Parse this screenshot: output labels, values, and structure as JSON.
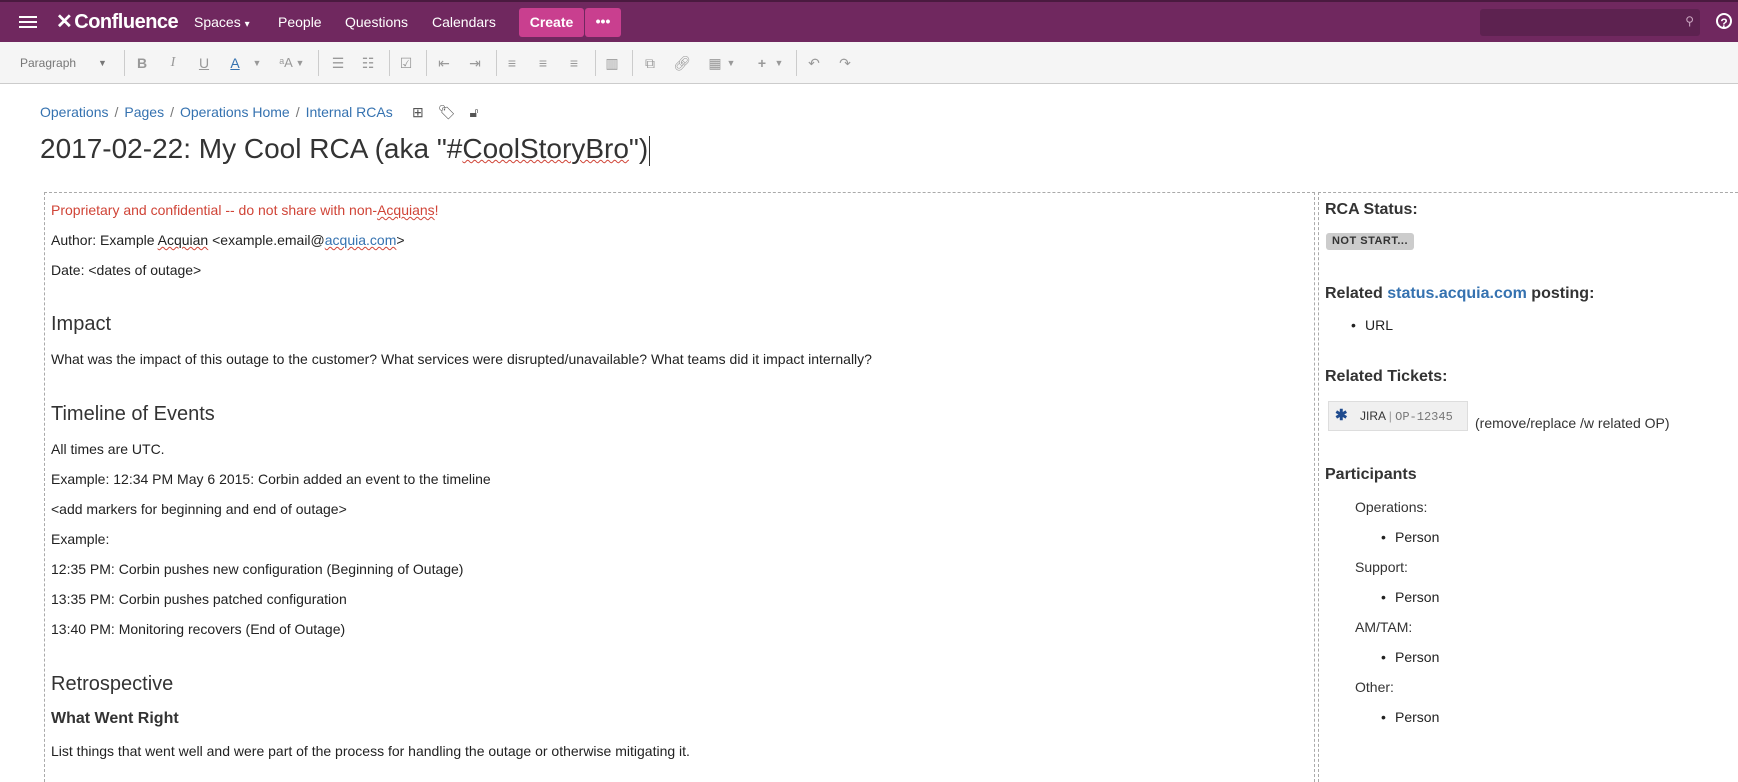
{
  "topbar": {
    "logo": "Confluence",
    "nav": [
      "Spaces",
      "People",
      "Questions",
      "Calendars"
    ],
    "spaces_caret": "▾",
    "create_label": "Create",
    "more_label": "•••",
    "search_placeholder": "",
    "help_label": "?"
  },
  "toolbar": {
    "paragraph_label": "Paragraph",
    "bold": "B",
    "italic": "I",
    "underline": "U",
    "text_color": "A",
    "text_style": "ᵃA"
  },
  "breadcrumb": [
    "Operations",
    "Pages",
    "Operations Home",
    "Internal RCAs"
  ],
  "title": "2017-02-22: My Cool RCA (aka \"#CoolStoryBro\")",
  "title_parts": {
    "pre": "2017-02-22: My Cool RCA (aka \"#",
    "squiggle": "CoolStoryBro",
    "post": "\")"
  },
  "body": {
    "confidential_pre": "Proprietary and confidential -- do not share with non-",
    "confidential_word": "Acquians",
    "confidential_post": "!",
    "author_pre": "Author: Example ",
    "author_name": "Acquian",
    "author_mid": " <example.email@",
    "author_link": "acquia.com",
    "author_post": ">",
    "date": "Date: <dates of outage>",
    "impact_heading": "Impact",
    "impact_text": "What was the impact of this outage to the customer?  What services were disrupted/unavailable?  What teams did it impact internally?",
    "timeline_heading": "Timeline of Events",
    "timeline_lines": [
      "All times are UTC.",
      "Example: 12:34 PM May 6 2015: Corbin added an event to the timeline",
      "<add markers for beginning and end of outage>",
      "Example:",
      "12:35 PM: Corbin pushes new configuration (Beginning of Outage)",
      "13:35 PM: Corbin pushes patched configuration",
      "13:40 PM: Monitoring recovers (End of Outage)"
    ],
    "retro_heading": "Retrospective",
    "went_right_heading": "What Went Right",
    "went_right_text": "List things that went well and were part of the process for handling the outage or otherwise mitigating it."
  },
  "sidebar": {
    "rca_status_label": "RCA Status:",
    "status_lozenge": "NOT START...",
    "related_pre": "Related ",
    "related_link": "status.acquia.com",
    "related_post": " posting:",
    "related_items": [
      "URL"
    ],
    "tickets_label": "Related Tickets:",
    "jira_label": "JIRA",
    "jira_key": "OP-12345",
    "jira_note": "(remove/replace /w related OP)",
    "participants_label": "Participants",
    "groups": [
      {
        "label": "Operations:",
        "person": "Person"
      },
      {
        "label": "Support:",
        "person": "Person"
      },
      {
        "label": "AM/TAM:",
        "person": "Person"
      },
      {
        "label": "Other:",
        "person": "Person"
      }
    ]
  }
}
